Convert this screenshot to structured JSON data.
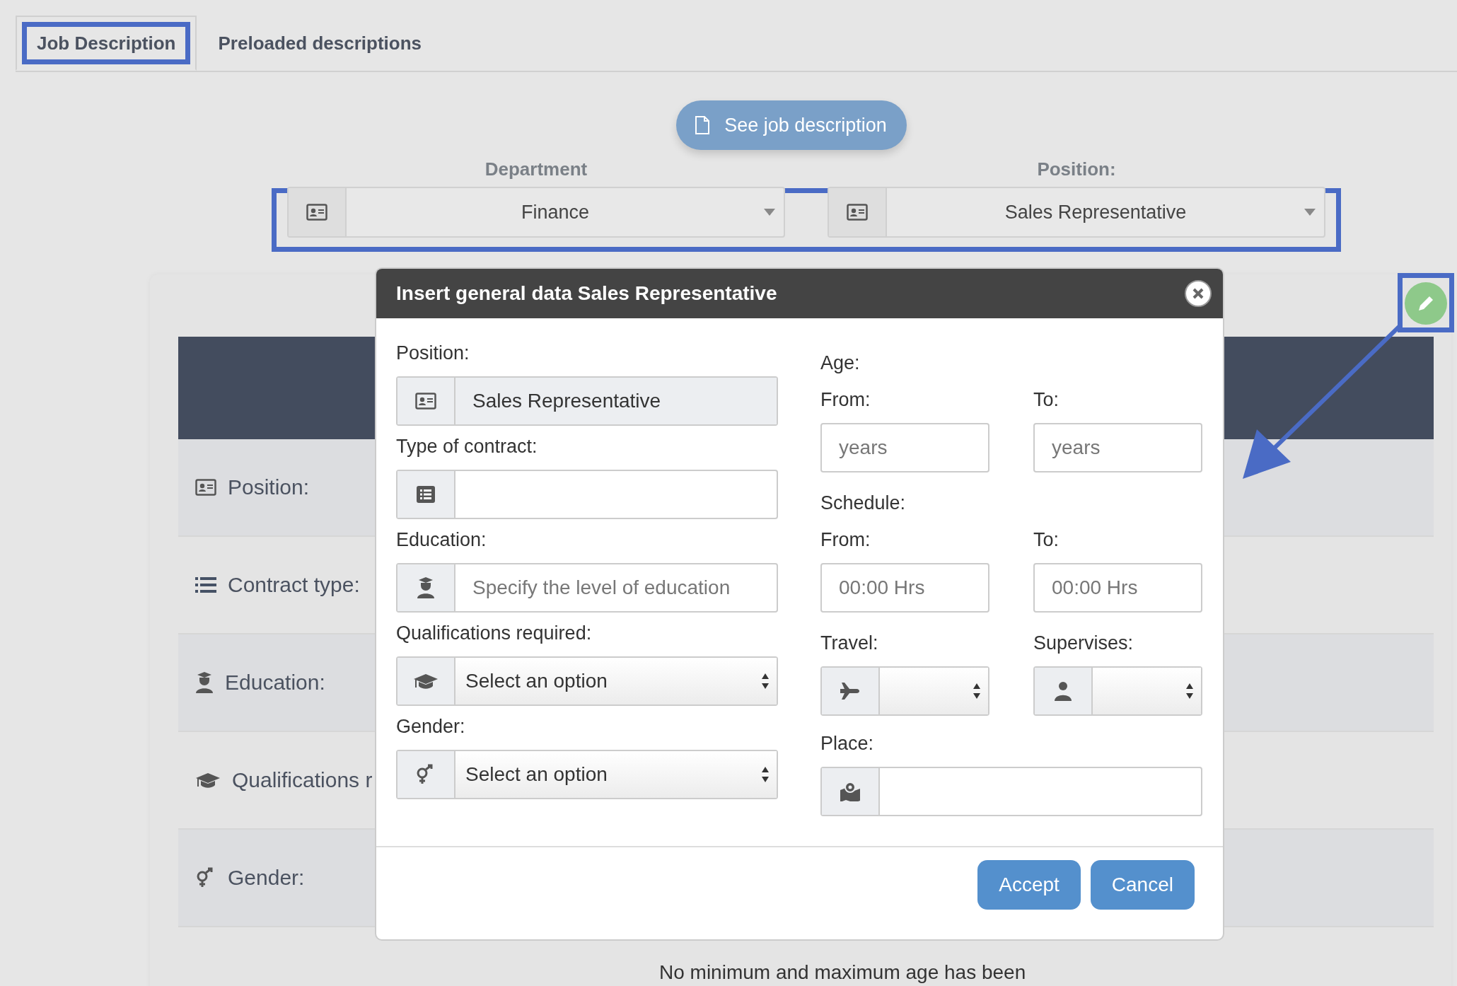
{
  "tabs": [
    {
      "label": "Job Description",
      "selected": true
    },
    {
      "label": "Preloaded descriptions",
      "selected": false
    }
  ],
  "see_button": {
    "label": "See job description"
  },
  "filters": [
    {
      "label": "Department",
      "value": "Finance"
    },
    {
      "label": "Position:",
      "value": "Sales Representative"
    }
  ],
  "background_rows": [
    {
      "label": "Position:"
    },
    {
      "label": "Contract type:"
    },
    {
      "label": "Education:"
    },
    {
      "label": "Qualifications r"
    },
    {
      "label": "Gender:"
    }
  ],
  "background_note": "No minimum and maximum age has been",
  "modal": {
    "title": "Insert general data Sales Representative",
    "left_fields": [
      {
        "label": "Position:",
        "kind": "readonly",
        "value": "Sales Representative"
      },
      {
        "label": "Type of contract:",
        "kind": "text"
      },
      {
        "label": "Education:",
        "kind": "text",
        "placeholder": "Specify the level of education"
      },
      {
        "label": "Qualifications required:",
        "kind": "select",
        "value": "Select an option"
      },
      {
        "label": "Gender:",
        "kind": "select",
        "value": "Select an option"
      }
    ],
    "age": {
      "label": "Age:",
      "from_label": "From:",
      "from_placeholder": "years",
      "to_label": "To:",
      "to_placeholder": "years"
    },
    "schedule": {
      "label": "Schedule:",
      "from_label": "From:",
      "from_placeholder": "00:00 Hrs",
      "to_label": "To:",
      "to_placeholder": "00:00 Hrs"
    },
    "travel": {
      "label": "Travel:"
    },
    "supervises": {
      "label": "Supervises:"
    },
    "place": {
      "label": "Place:"
    },
    "buttons": [
      {
        "label": "Accept"
      },
      {
        "label": "Cancel"
      }
    ]
  }
}
